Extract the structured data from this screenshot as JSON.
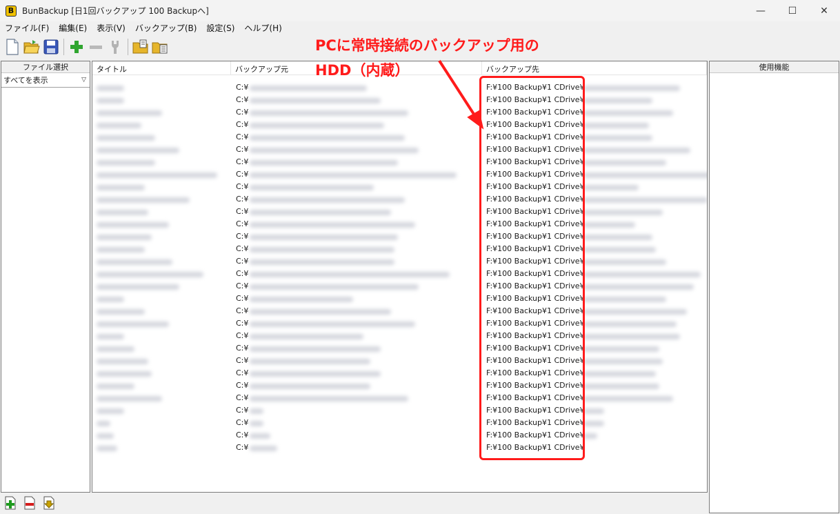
{
  "window": {
    "title": "BunBackup [日1回バックアップ 100 Backupへ]",
    "minimize": "—",
    "maximize": "☐",
    "close": "✕"
  },
  "menu": [
    "ファイル(F)",
    "編集(E)",
    "表示(V)",
    "バックアップ(B)",
    "設定(S)",
    "ヘルプ(H)"
  ],
  "left_panel": {
    "header": "ファイル選択",
    "dropdown_value": "すべてを表示"
  },
  "list": {
    "columns": [
      "タイトル",
      "バックアップ元",
      "バックアップ先"
    ],
    "source_prefix": "C:¥",
    "dest_prefix": "F:¥100 Backup¥1 CDrive¥",
    "row_count": 30
  },
  "right_panel": {
    "header": "使用機能"
  },
  "annotation": {
    "line1": "PCに常時接続のバックアップ用の",
    "line2": "HDD（内蔵）",
    "color": "#ff1b1b"
  },
  "toolbar_icons": [
    "new-file-icon",
    "open-folder-icon",
    "save-icon",
    "add-icon",
    "remove-icon",
    "settings-tool-icon",
    "folder-copy-icon",
    "folder-paste-icon"
  ],
  "bottom_icons": [
    "add-file-icon",
    "remove-file-icon",
    "download-file-icon"
  ]
}
